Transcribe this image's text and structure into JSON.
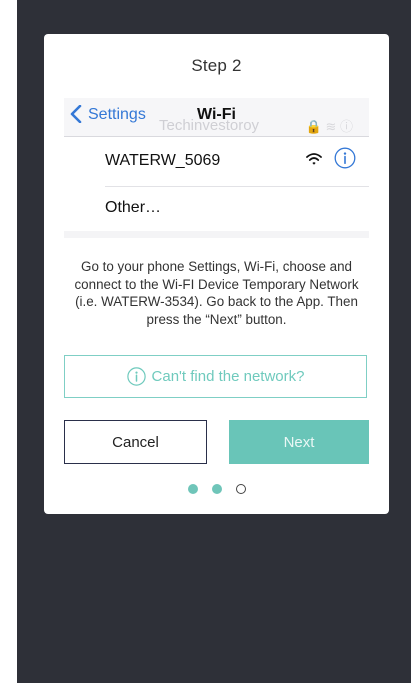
{
  "dialog": {
    "title": "Step 2",
    "instructions": "Go to your phone Settings, Wi-Fi, choose and connect to the Wi-FI Device Temporary Network (i.e. WATERW-3534). Go back to the App. Then press the “Next” button.",
    "cant_find_label": "Can't find the network?",
    "cancel_label": "Cancel",
    "next_label": "Next",
    "pagination": {
      "total": 3,
      "active": 2
    }
  },
  "settings_mock": {
    "back_label": "Settings",
    "nav_title": "Wi-Fi",
    "faded_network": "Techinvestoroy",
    "networks": [
      {
        "name": "WATERW_5069",
        "icons": [
          "wifi-icon",
          "info-icon"
        ]
      },
      {
        "name": "Other…"
      }
    ]
  },
  "colors": {
    "accent_teal": "#69c5b8",
    "ios_blue": "#3478d6",
    "backdrop": "#2e3038",
    "cancel_border": "#2a2f4a"
  }
}
